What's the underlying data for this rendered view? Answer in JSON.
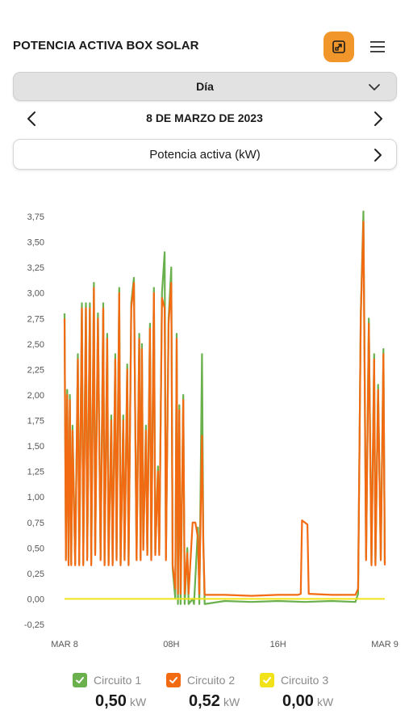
{
  "header": {
    "title": "POTENCIA ACTIVA BOX SOLAR",
    "expand_icon": "expand-icon",
    "menu_icon": "hamburger-menu-icon",
    "accent": "#f0962a"
  },
  "period": {
    "selected": "Día"
  },
  "date_nav": {
    "label": "8 DE MARZO DE 2023"
  },
  "metric": {
    "selected": "Potencia activa (kW)"
  },
  "chart_data": {
    "type": "line",
    "title": "",
    "xlabel": "",
    "ylabel": "",
    "x_ticks": [
      "MAR 8",
      "08H",
      "16H",
      "MAR 9"
    ],
    "x_range_hours": [
      0,
      24
    ],
    "y_ticks": [
      "3,75",
      "3,50",
      "3,25",
      "3,00",
      "2,75",
      "2,50",
      "2,25",
      "2,00",
      "1,75",
      "1,50",
      "1,25",
      "1,00",
      "0,75",
      "0,50",
      "0,25",
      "0,00",
      "-0,25"
    ],
    "ylim": [
      -0.25,
      3.75
    ],
    "grid": false,
    "legend_position": "bottom",
    "series": [
      {
        "name": "Circuito 1",
        "color": "#6ab04c",
        "points": [
          [
            0,
            2.8
          ],
          [
            0.1,
            0.4
          ],
          [
            0.2,
            2.05
          ],
          [
            0.3,
            0.35
          ],
          [
            0.4,
            2.0
          ],
          [
            0.5,
            0.35
          ],
          [
            0.6,
            1.7
          ],
          [
            0.8,
            0.35
          ],
          [
            1.0,
            2.4
          ],
          [
            1.1,
            0.35
          ],
          [
            1.3,
            2.9
          ],
          [
            1.4,
            0.35
          ],
          [
            1.6,
            2.9
          ],
          [
            1.7,
            0.4
          ],
          [
            1.9,
            2.9
          ],
          [
            2.0,
            0.35
          ],
          [
            2.2,
            3.1
          ],
          [
            2.3,
            0.45
          ],
          [
            2.5,
            2.8
          ],
          [
            2.7,
            0.4
          ],
          [
            2.9,
            2.9
          ],
          [
            3.0,
            0.35
          ],
          [
            3.2,
            2.6
          ],
          [
            3.3,
            0.35
          ],
          [
            3.5,
            1.8
          ],
          [
            3.6,
            0.35
          ],
          [
            3.8,
            2.4
          ],
          [
            3.9,
            0.4
          ],
          [
            4.1,
            3.05
          ],
          [
            4.2,
            0.35
          ],
          [
            4.4,
            1.8
          ],
          [
            4.5,
            0.4
          ],
          [
            4.7,
            2.3
          ],
          [
            4.8,
            0.35
          ],
          [
            5.0,
            2.9
          ],
          [
            5.2,
            3.15
          ],
          [
            5.4,
            0.4
          ],
          [
            5.6,
            2.6
          ],
          [
            5.7,
            0.4
          ],
          [
            5.8,
            2.5
          ],
          [
            5.9,
            0.5
          ],
          [
            6.1,
            1.7
          ],
          [
            6.2,
            0.45
          ],
          [
            6.4,
            2.7
          ],
          [
            6.5,
            0.4
          ],
          [
            6.7,
            3.05
          ],
          [
            6.8,
            0.45
          ],
          [
            7.0,
            1.3
          ],
          [
            7.1,
            0.45
          ],
          [
            7.3,
            3.0
          ],
          [
            7.5,
            3.4
          ],
          [
            7.6,
            0.4
          ],
          [
            7.8,
            2.75
          ],
          [
            8.0,
            3.25
          ],
          [
            8.1,
            0.3
          ],
          [
            8.3,
            0.0
          ],
          [
            8.4,
            2.6
          ],
          [
            8.5,
            -0.05
          ],
          [
            8.6,
            1.9
          ],
          [
            8.7,
            -0.05
          ],
          [
            8.9,
            2.0
          ],
          [
            9.0,
            -0.05
          ],
          [
            9.2,
            0.5
          ],
          [
            9.3,
            -0.05
          ],
          [
            9.6,
            0.0
          ],
          [
            9.7,
            -0.05
          ],
          [
            10.0,
            0.7
          ],
          [
            10.1,
            -0.05
          ],
          [
            10.3,
            2.4
          ],
          [
            10.4,
            0.6
          ],
          [
            10.5,
            -0.05
          ],
          [
            12.0,
            -0.02
          ],
          [
            14.0,
            -0.03
          ],
          [
            16.0,
            -0.02
          ],
          [
            18.0,
            -0.03
          ],
          [
            20.0,
            -0.02
          ],
          [
            21.8,
            -0.03
          ],
          [
            22.0,
            0.05
          ],
          [
            22.2,
            2.8
          ],
          [
            22.4,
            3.8
          ],
          [
            22.6,
            0.4
          ],
          [
            22.8,
            2.75
          ],
          [
            23.0,
            0.35
          ],
          [
            23.2,
            2.4
          ],
          [
            23.3,
            0.35
          ],
          [
            23.5,
            2.1
          ],
          [
            23.7,
            0.4
          ],
          [
            23.9,
            2.45
          ],
          [
            24.0,
            0.35
          ]
        ]
      },
      {
        "name": "Circuito 2",
        "color": "#f26a12",
        "points": [
          [
            0,
            2.75
          ],
          [
            0.1,
            0.38
          ],
          [
            0.2,
            2.0
          ],
          [
            0.3,
            0.33
          ],
          [
            0.4,
            1.95
          ],
          [
            0.5,
            0.33
          ],
          [
            0.6,
            1.65
          ],
          [
            0.8,
            0.33
          ],
          [
            1.0,
            2.35
          ],
          [
            1.1,
            0.33
          ],
          [
            1.3,
            2.85
          ],
          [
            1.4,
            0.33
          ],
          [
            1.6,
            2.85
          ],
          [
            1.7,
            0.38
          ],
          [
            1.9,
            2.85
          ],
          [
            2.0,
            0.33
          ],
          [
            2.2,
            3.05
          ],
          [
            2.3,
            0.43
          ],
          [
            2.5,
            2.75
          ],
          [
            2.7,
            0.38
          ],
          [
            2.9,
            2.85
          ],
          [
            3.0,
            0.33
          ],
          [
            3.2,
            2.55
          ],
          [
            3.3,
            0.33
          ],
          [
            3.5,
            1.75
          ],
          [
            3.6,
            0.33
          ],
          [
            3.8,
            2.35
          ],
          [
            3.9,
            0.38
          ],
          [
            4.1,
            3.0
          ],
          [
            4.2,
            0.33
          ],
          [
            4.4,
            1.75
          ],
          [
            4.5,
            0.38
          ],
          [
            4.7,
            2.25
          ],
          [
            4.8,
            0.33
          ],
          [
            5.0,
            2.85
          ],
          [
            5.2,
            3.1
          ],
          [
            5.4,
            0.38
          ],
          [
            5.6,
            2.55
          ],
          [
            5.7,
            0.38
          ],
          [
            5.8,
            2.45
          ],
          [
            5.9,
            0.48
          ],
          [
            6.1,
            1.65
          ],
          [
            6.2,
            0.43
          ],
          [
            6.4,
            2.65
          ],
          [
            6.5,
            0.38
          ],
          [
            6.7,
            3.0
          ],
          [
            6.8,
            0.43
          ],
          [
            7.0,
            1.25
          ],
          [
            7.1,
            0.43
          ],
          [
            7.3,
            2.95
          ],
          [
            7.5,
            2.85
          ],
          [
            7.6,
            0.38
          ],
          [
            7.8,
            2.7
          ],
          [
            8.0,
            3.1
          ],
          [
            8.1,
            0.33
          ],
          [
            8.3,
            0.1
          ],
          [
            8.4,
            2.55
          ],
          [
            8.5,
            0.05
          ],
          [
            8.6,
            1.85
          ],
          [
            8.7,
            0.05
          ],
          [
            8.9,
            1.95
          ],
          [
            9.0,
            0.05
          ],
          [
            9.2,
            0.45
          ],
          [
            9.3,
            0.05
          ],
          [
            9.6,
            0.75
          ],
          [
            9.8,
            0.75
          ],
          [
            10.0,
            0.6
          ],
          [
            10.1,
            0.05
          ],
          [
            10.3,
            1.6
          ],
          [
            10.4,
            0.55
          ],
          [
            10.5,
            0.04
          ],
          [
            12.0,
            0.04
          ],
          [
            14.0,
            0.03
          ],
          [
            16.0,
            0.04
          ],
          [
            17.5,
            0.04
          ],
          [
            17.7,
            0.05
          ],
          [
            17.8,
            0.77
          ],
          [
            18.2,
            0.73
          ],
          [
            18.3,
            0.05
          ],
          [
            20.0,
            0.04
          ],
          [
            21.8,
            0.04
          ],
          [
            22.0,
            0.1
          ],
          [
            22.2,
            2.75
          ],
          [
            22.4,
            3.7
          ],
          [
            22.6,
            0.38
          ],
          [
            22.8,
            2.7
          ],
          [
            23.0,
            0.33
          ],
          [
            23.2,
            2.35
          ],
          [
            23.3,
            0.33
          ],
          [
            23.5,
            2.05
          ],
          [
            23.7,
            0.38
          ],
          [
            23.9,
            2.4
          ],
          [
            24.0,
            0.33
          ]
        ]
      },
      {
        "name": "Circuito 3",
        "color": "#f2e21a",
        "points": [
          [
            0,
            0.0
          ],
          [
            24,
            0.0
          ]
        ]
      }
    ]
  },
  "legend": [
    {
      "name": "Circuito 1",
      "value": "0,50",
      "unit": "kW",
      "color": "#6ab04c"
    },
    {
      "name": "Circuito 2",
      "value": "0,52",
      "unit": "kW",
      "color": "#f26a12"
    },
    {
      "name": "Circuito 3",
      "value": "0,00",
      "unit": "kW",
      "color": "#f2e21a"
    }
  ]
}
